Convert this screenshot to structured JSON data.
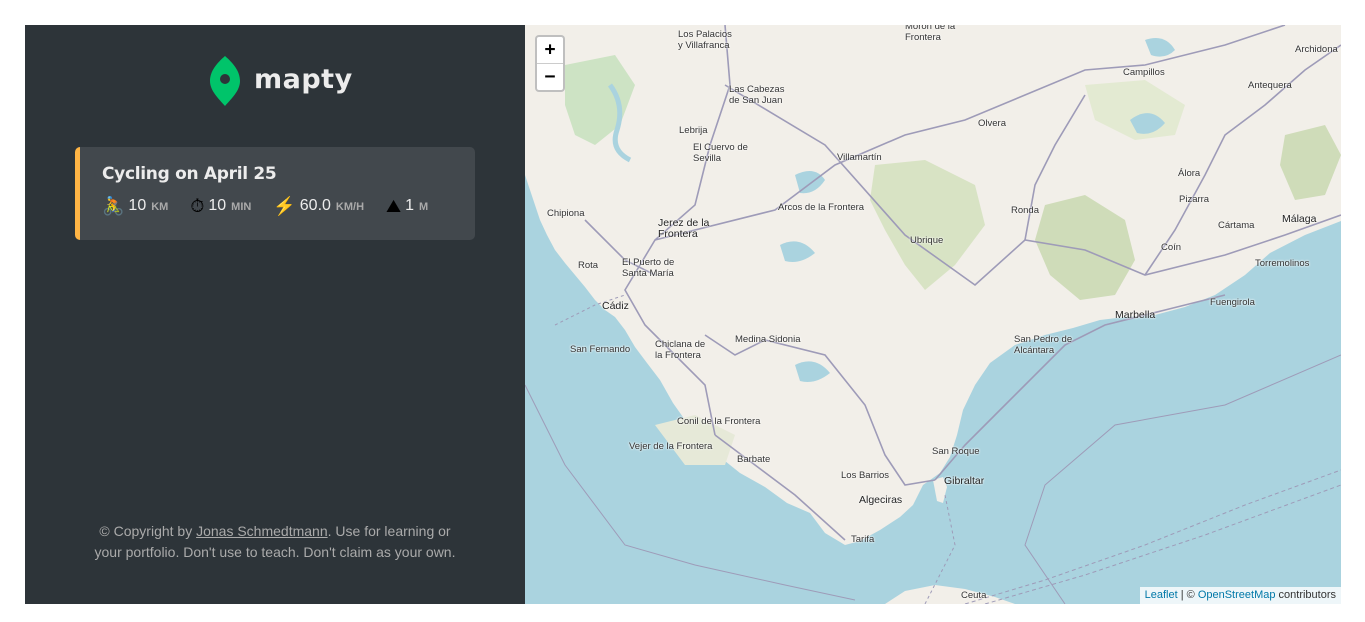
{
  "sidebar": {
    "logo_text": "mapty",
    "workout": {
      "title": "Cycling on April 25",
      "details": [
        {
          "icon": "🚴",
          "value": "10",
          "unit": "km"
        },
        {
          "icon": "⏱",
          "value": "10",
          "unit": "min"
        },
        {
          "icon": "⚡️",
          "value": "60.0",
          "unit": "km/h"
        },
        {
          "icon": "⛰",
          "value": "1",
          "unit": "m"
        }
      ]
    },
    "copyright": {
      "prefix": "© Copyright by ",
      "author": "Jonas Schmedtmann",
      "suffix": ". Use for learning or your portfolio. Don't use to teach. Don't claim as your own."
    }
  },
  "map": {
    "zoom_in": "+",
    "zoom_out": "−",
    "attribution": {
      "leaflet": "Leaflet",
      "separator": " | © ",
      "osm": "OpenStreetMap",
      "suffix": " contributors"
    },
    "places": [
      "Los Palacios\ny Villafranca",
      "Morón de la\nFrontera",
      "Archidona",
      "Campillos",
      "Antequera",
      "Las Cabezas\nde San Juan",
      "Olvera",
      "Lebrija",
      "El Cuervo de\nSevilla",
      "Villamartín",
      "Álora",
      "Pizarra",
      "Chipiona",
      "Arcos de la Frontera",
      "Ronda",
      "Cártama",
      "Málaga",
      "Jerez de la\nFrontera",
      "Ubrique",
      "Coín",
      "Rota",
      "El Puerto de\nSanta María",
      "Torremolinos",
      "Cádiz",
      "Fuengirola",
      "Marbella",
      "San Fernando",
      "Chiclana de\nla Frontera",
      "Medina Sidonia",
      "San Pedro de\nAlcántara",
      "Conil de la Frontera",
      "Vejer de la Frontera",
      "Barbate",
      "San Roque",
      "Los Barrios",
      "Gibraltar",
      "Algeciras",
      "Tarifa",
      "Ceuta"
    ]
  }
}
